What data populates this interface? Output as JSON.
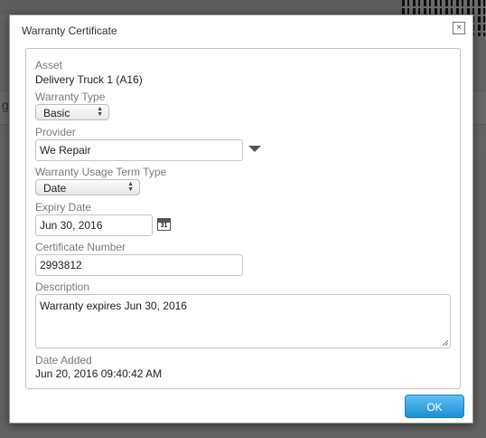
{
  "background": {
    "partial_text": "g/"
  },
  "dialog": {
    "title": "Warranty Certificate",
    "close_glyph": "×",
    "fields": {
      "asset": {
        "label": "Asset",
        "value": "Delivery Truck 1 (A16)"
      },
      "warranty_type": {
        "label": "Warranty Type",
        "selected": "Basic"
      },
      "provider": {
        "label": "Provider",
        "value": "We Repair"
      },
      "usage_term_type": {
        "label": "Warranty Usage Term Type",
        "selected": "Date"
      },
      "expiry_date": {
        "label": "Expiry Date",
        "value": "Jun 30, 2016",
        "calendar_icon_text": "31"
      },
      "certificate_number": {
        "label": "Certificate Number",
        "value": "2993812"
      },
      "description": {
        "label": "Description",
        "value": "Warranty expires Jun 30, 2016"
      },
      "date_added": {
        "label": "Date Added",
        "value": "Jun 20, 2016 09:40:42 AM"
      }
    },
    "ok_label": "OK"
  },
  "colors": {
    "ok_button": "#1d8fd6",
    "label_gray": "#7b7b7b"
  }
}
